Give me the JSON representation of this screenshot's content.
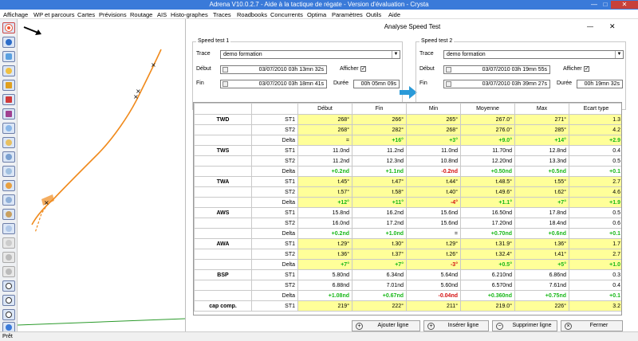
{
  "window": {
    "title": "Adrena V10.0.2.7 - Aide à la tactique de régate - Version d'évaluation - Crysta",
    "min": "—",
    "max": "□",
    "close": "✕"
  },
  "menu": [
    "Affichage",
    "WP et parcours",
    "Cartes",
    "Prévisions",
    "Routage",
    "AIS",
    "Histo-graphes",
    "Traces",
    "Roadbooks",
    "Concurrents",
    "Optima",
    "Paramètres",
    "Outils",
    "Aide"
  ],
  "status": "Prêt",
  "dialog": {
    "title": "Analyse Speed Test",
    "min": "—",
    "close": "✕",
    "st1": {
      "group": "Speed test 1",
      "trace_label": "Trace",
      "trace_value": "demo formation",
      "debut_label": "Début",
      "debut_value": "03/07/2010  03h 13mn 32s",
      "fin_label": "Fin",
      "fin_value": "03/07/2010  03h 18mn 41s",
      "afficher_label": "Afficher",
      "afficher_checked": "✓",
      "duree_label": "Durée",
      "duree_value": "00h 05mn 09s"
    },
    "st2": {
      "group": "Speed test 2",
      "trace_label": "Trace",
      "trace_value": "demo formation",
      "debut_label": "Début",
      "debut_value": "03/07/2010  03h 19mn 55s",
      "fin_label": "Fin",
      "fin_value": "03/07/2010  03h 39mn 27s",
      "afficher_label": "Afficher",
      "afficher_checked": "✓",
      "duree_label": "Durée",
      "duree_value": "00h 19mn 32s"
    },
    "table": {
      "headers": [
        "",
        "",
        "Début",
        "Fin",
        "Min",
        "Moyenne",
        "Max",
        "Ecart type"
      ],
      "groups": [
        {
          "name": "TWD",
          "hl": true,
          "rows": [
            {
              "sub": "ST1",
              "vals": [
                "268°",
                "266°",
                "265°",
                "267.0°",
                "271°",
                "1.3"
              ]
            },
            {
              "sub": "ST2",
              "vals": [
                "268°",
                "282°",
                "268°",
                "276.0°",
                "285°",
                "4.2"
              ]
            },
            {
              "sub": "Delta",
              "vals": [
                "=",
                "+16°",
                "+3°",
                "+9.0°",
                "+14°",
                "+2.9"
              ],
              "cls": [
                "",
                "pos",
                "pos",
                "pos",
                "pos",
                "pos"
              ]
            }
          ]
        },
        {
          "name": "TWS",
          "hl": false,
          "rows": [
            {
              "sub": "ST1",
              "vals": [
                "11.0nd",
                "11.2nd",
                "11.0nd",
                "11.70nd",
                "12.8nd",
                "0.4"
              ]
            },
            {
              "sub": "ST2",
              "vals": [
                "11.2nd",
                "12.3nd",
                "10.8nd",
                "12.20nd",
                "13.3nd",
                "0.5"
              ]
            },
            {
              "sub": "Delta",
              "vals": [
                "+0.2nd",
                "+1.1nd",
                "-0.2nd",
                "+0.50nd",
                "+0.5nd",
                "+0.1"
              ],
              "cls": [
                "pos",
                "pos",
                "neg",
                "pos",
                "pos",
                "pos"
              ]
            }
          ]
        },
        {
          "name": "TWA",
          "hl": true,
          "rows": [
            {
              "sub": "ST1",
              "vals": [
                "t.45°",
                "t.47°",
                "t.44°",
                "t.48.5°",
                "t.55°",
                "2.7"
              ]
            },
            {
              "sub": "ST2",
              "vals": [
                "t.57°",
                "t.58°",
                "t.40°",
                "t.49.6°",
                "t.62°",
                "4.6"
              ]
            },
            {
              "sub": "Delta",
              "vals": [
                "+12°",
                "+11°",
                "-4°",
                "+1.1°",
                "+7°",
                "+1.9"
              ],
              "cls": [
                "pos",
                "pos",
                "neg",
                "pos",
                "pos",
                "pos"
              ]
            }
          ]
        },
        {
          "name": "AWS",
          "hl": false,
          "rows": [
            {
              "sub": "ST1",
              "vals": [
                "15.8nd",
                "16.2nd",
                "15.6nd",
                "16.50nd",
                "17.8nd",
                "0.5"
              ]
            },
            {
              "sub": "ST2",
              "vals": [
                "16.0nd",
                "17.2nd",
                "15.6nd",
                "17.20nd",
                "18.4nd",
                "0.6"
              ]
            },
            {
              "sub": "Delta",
              "vals": [
                "+0.2nd",
                "+1.0nd",
                "=",
                "+0.70nd",
                "+0.6nd",
                "+0.1"
              ],
              "cls": [
                "pos",
                "pos",
                "",
                "pos",
                "pos",
                "pos"
              ]
            }
          ]
        },
        {
          "name": "AWA",
          "hl": true,
          "rows": [
            {
              "sub": "ST1",
              "vals": [
                "t.29°",
                "t.30°",
                "t.29°",
                "t.31.9°",
                "t.36°",
                "1.7"
              ]
            },
            {
              "sub": "ST2",
              "vals": [
                "t.36°",
                "t.37°",
                "t.26°",
                "t.32.4°",
                "t.41°",
                "2.7"
              ]
            },
            {
              "sub": "Delta",
              "vals": [
                "+7°",
                "+7°",
                "-3°",
                "+0.5°",
                "+5°",
                "+1.0"
              ],
              "cls": [
                "pos",
                "pos",
                "neg",
                "pos",
                "pos",
                "pos"
              ]
            }
          ]
        },
        {
          "name": "BSP",
          "hl": false,
          "rows": [
            {
              "sub": "ST1",
              "vals": [
                "5.80nd",
                "6.34nd",
                "5.64nd",
                "6.210nd",
                "6.86nd",
                "0.3"
              ]
            },
            {
              "sub": "ST2",
              "vals": [
                "6.88nd",
                "7.01nd",
                "5.60nd",
                "6.570nd",
                "7.61nd",
                "0.4"
              ]
            },
            {
              "sub": "Delta",
              "vals": [
                "+1.08nd",
                "+0.67nd",
                "-0.04nd",
                "+0.360nd",
                "+0.75nd",
                "+0.1"
              ],
              "cls": [
                "pos",
                "pos",
                "neg",
                "pos",
                "pos",
                "pos"
              ]
            }
          ]
        },
        {
          "name": "cap comp.",
          "hl": true,
          "rows": [
            {
              "sub": "ST1",
              "vals": [
                "219°",
                "222°",
                "211°",
                "219.0°",
                "226°",
                "3.2"
              ]
            }
          ]
        }
      ]
    },
    "buttons": {
      "add": "Ajouter ligne",
      "insert": "Insérer ligne",
      "delete": "Supprimer ligne",
      "close": "Fermer"
    }
  },
  "colors": {
    "titlebar": "#3a7ad9",
    "highlight": "#ffff99",
    "positive": "#18b818",
    "negative": "#d51010",
    "track": "#f08a1c"
  }
}
